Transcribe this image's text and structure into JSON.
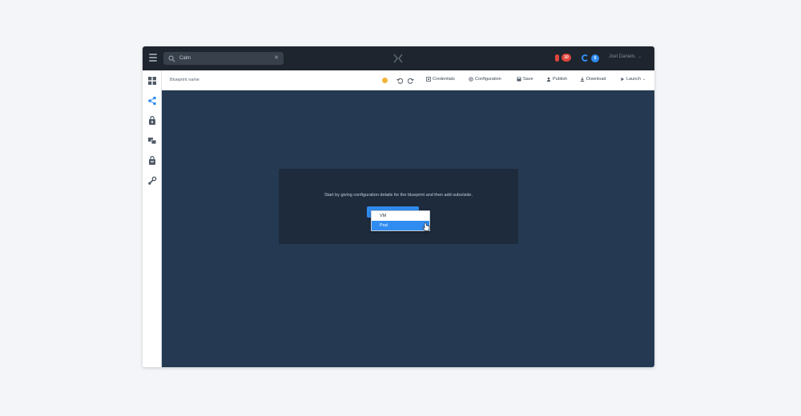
{
  "app": {
    "search": {
      "value": "Calm"
    },
    "user_name": "Joel Daniels",
    "alert_count": "10",
    "help_count": "0"
  },
  "toolbar": {
    "blueprint_name_placeholder": "Blueprint name",
    "buttons": [
      "Credentials",
      "Configuration",
      "Save",
      "Publish",
      "Download",
      "Launch"
    ]
  },
  "sidebar": {
    "icons": [
      "dashboard-icon",
      "blueprint-icon",
      "marketplace-icon",
      "apps-icon",
      "projects-icon",
      "settings-icon"
    ]
  },
  "canvas": {
    "message": "Start by giving configuration details for the blueprint and then add subs/side.",
    "dropdown_options": [
      "VM",
      "Pod"
    ],
    "selected_option": "Pod"
  },
  "colors": {
    "topbar": "#1e252e",
    "canvas": "#253a52",
    "modal": "#1d2b3c",
    "accent": "#2f8cf0",
    "alert": "#e0453c",
    "status": "#f2b53a"
  }
}
